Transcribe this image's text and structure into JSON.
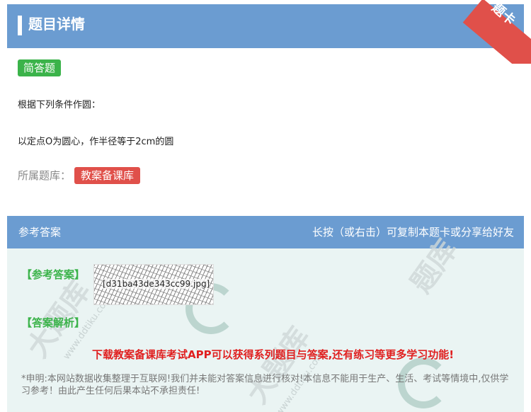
{
  "header": {
    "title": "题目详情",
    "corner_tag": "题卡"
  },
  "question": {
    "type_badge": "简答题",
    "line1": "根据下列条件作圆：",
    "line2": "以定点O为圆心，作半径等于2cm的圆",
    "bank_label": "所属题库：",
    "bank_name": "教案备课库"
  },
  "answer_section": {
    "title": "参考答案",
    "hint": "长按（或右击）可复制本题卡或分享给好友",
    "ref_label": "【参考答案】",
    "image_filename": "[d31ba43de343cc99.jpg]",
    "explain_label": "【答案解析】",
    "promo": "下载教案备课库考试APP可以获得系列题目与答案,还有练习等更多学习功能!",
    "notice": "*申明:本网站数据收集整理于互联网!我们并未能对答案信息进行核对!本信息不能用于生产、生活、考试等情境中,仅供学习参考！由此产生任何后果本站不承担责任!"
  },
  "watermark": {
    "text": "大题库",
    "domain": "www.ddtiku.com"
  },
  "colors": {
    "header_blue": "#6b9cd1",
    "badge_green": "#3bb34a",
    "badge_red": "#e0504a",
    "answer_bg": "#eaf4f3",
    "promo_red": "#e02020"
  }
}
